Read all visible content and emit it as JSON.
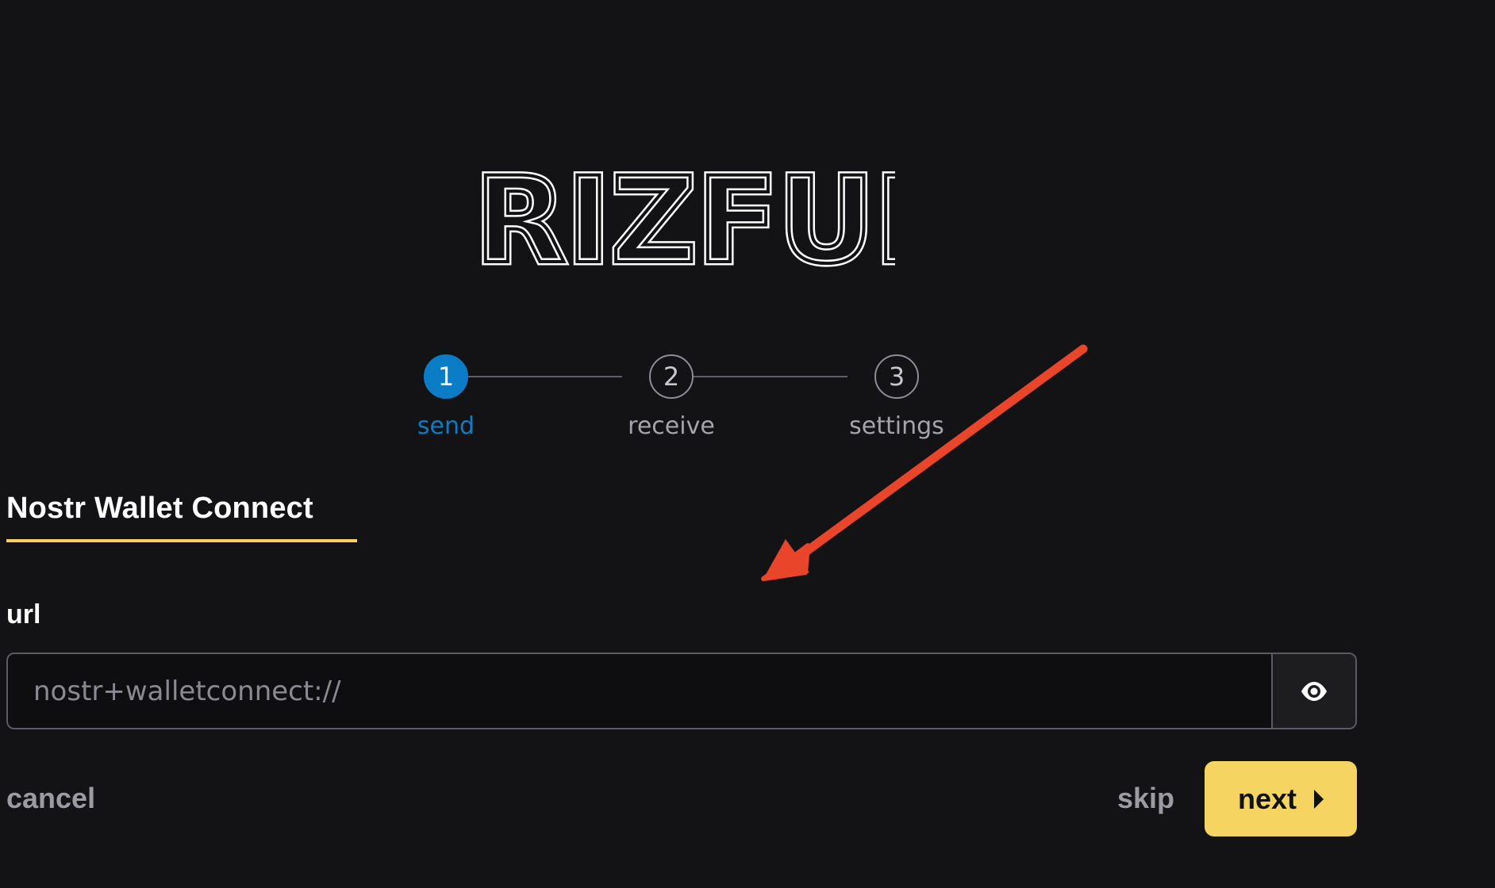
{
  "app": {
    "logo_text": "RIZFUL"
  },
  "stepper": {
    "steps": [
      {
        "number": "1",
        "label": "send",
        "active": true
      },
      {
        "number": "2",
        "label": "receive",
        "active": false
      },
      {
        "number": "3",
        "label": "settings",
        "active": false
      }
    ]
  },
  "section": {
    "title": "Nostr Wallet Connect"
  },
  "form": {
    "url_label": "url",
    "url_value": "",
    "url_placeholder": "nostr+walletconnect://",
    "toggle_visibility_icon": "eye-icon"
  },
  "footer": {
    "cancel_label": "cancel",
    "skip_label": "skip",
    "next_label": "next"
  },
  "colors": {
    "background": "#131315",
    "active_step": "#0a7dc6",
    "accent_yellow": "#f5d462",
    "annotation_arrow": "#e8452a"
  }
}
